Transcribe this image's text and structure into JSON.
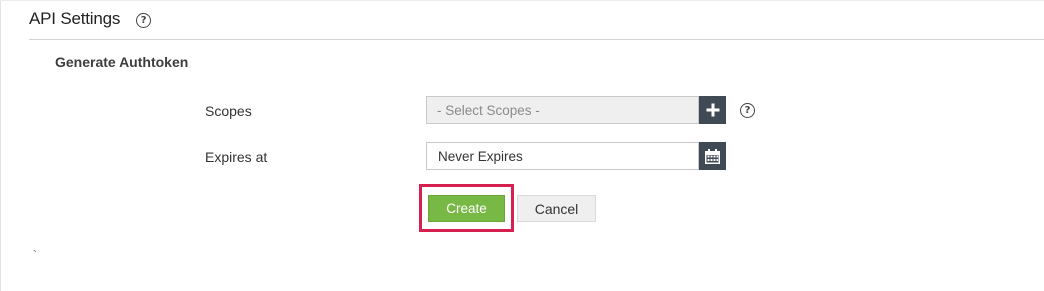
{
  "header": {
    "title": "API Settings",
    "help_icon": "help-circle-icon",
    "help_glyph": "?"
  },
  "section": {
    "title": "Generate Authtoken"
  },
  "form": {
    "scopes": {
      "label": "Scopes",
      "placeholder": "- Select Scopes -",
      "add_icon": "plus-icon",
      "help_icon": "help-circle-icon",
      "help_glyph": "?"
    },
    "expires": {
      "label": "Expires at",
      "value": "Never Expires",
      "calendar_icon": "calendar-icon"
    }
  },
  "actions": {
    "create_label": "Create",
    "cancel_label": "Cancel"
  },
  "stray_mark": "`",
  "colors": {
    "primary_green": "#78b845",
    "icon_button_bg": "#3f4a55",
    "highlight_red": "#d6204e",
    "divider": "#d4d4d4"
  }
}
